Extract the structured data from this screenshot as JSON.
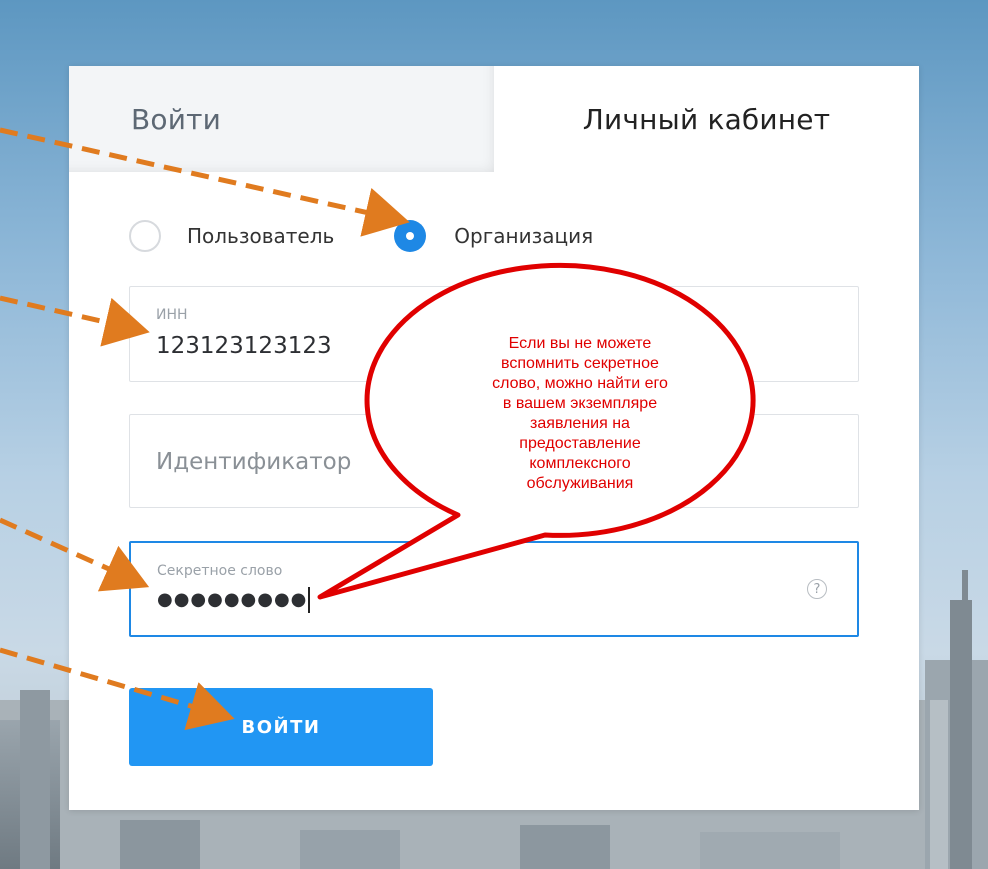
{
  "tabs": {
    "login": "Войти",
    "cabinet": "Личный кабинет"
  },
  "account_type": {
    "user": "Пользователь",
    "organization": "Организация",
    "selected": "organization"
  },
  "fields": {
    "inn": {
      "label": "ИНН",
      "value": "123123123123"
    },
    "identifier": {
      "placeholder": "Идентификатор"
    },
    "secret": {
      "label": "Секретное слово",
      "value": "●●●●●●●●●"
    }
  },
  "help_icon": "?",
  "login_button": "войти",
  "callout": {
    "lines": [
      "Если вы не можете",
      "вспомнить секретное",
      "слово, можно найти его",
      "в вашем экземпляре",
      "заявления на",
      "предоставление",
      "комплексного",
      "обслуживания"
    ]
  },
  "colors": {
    "accent": "#1e88e5",
    "button": "#2196f3",
    "arrow": "#e07b1f",
    "callout": "#e00000"
  }
}
